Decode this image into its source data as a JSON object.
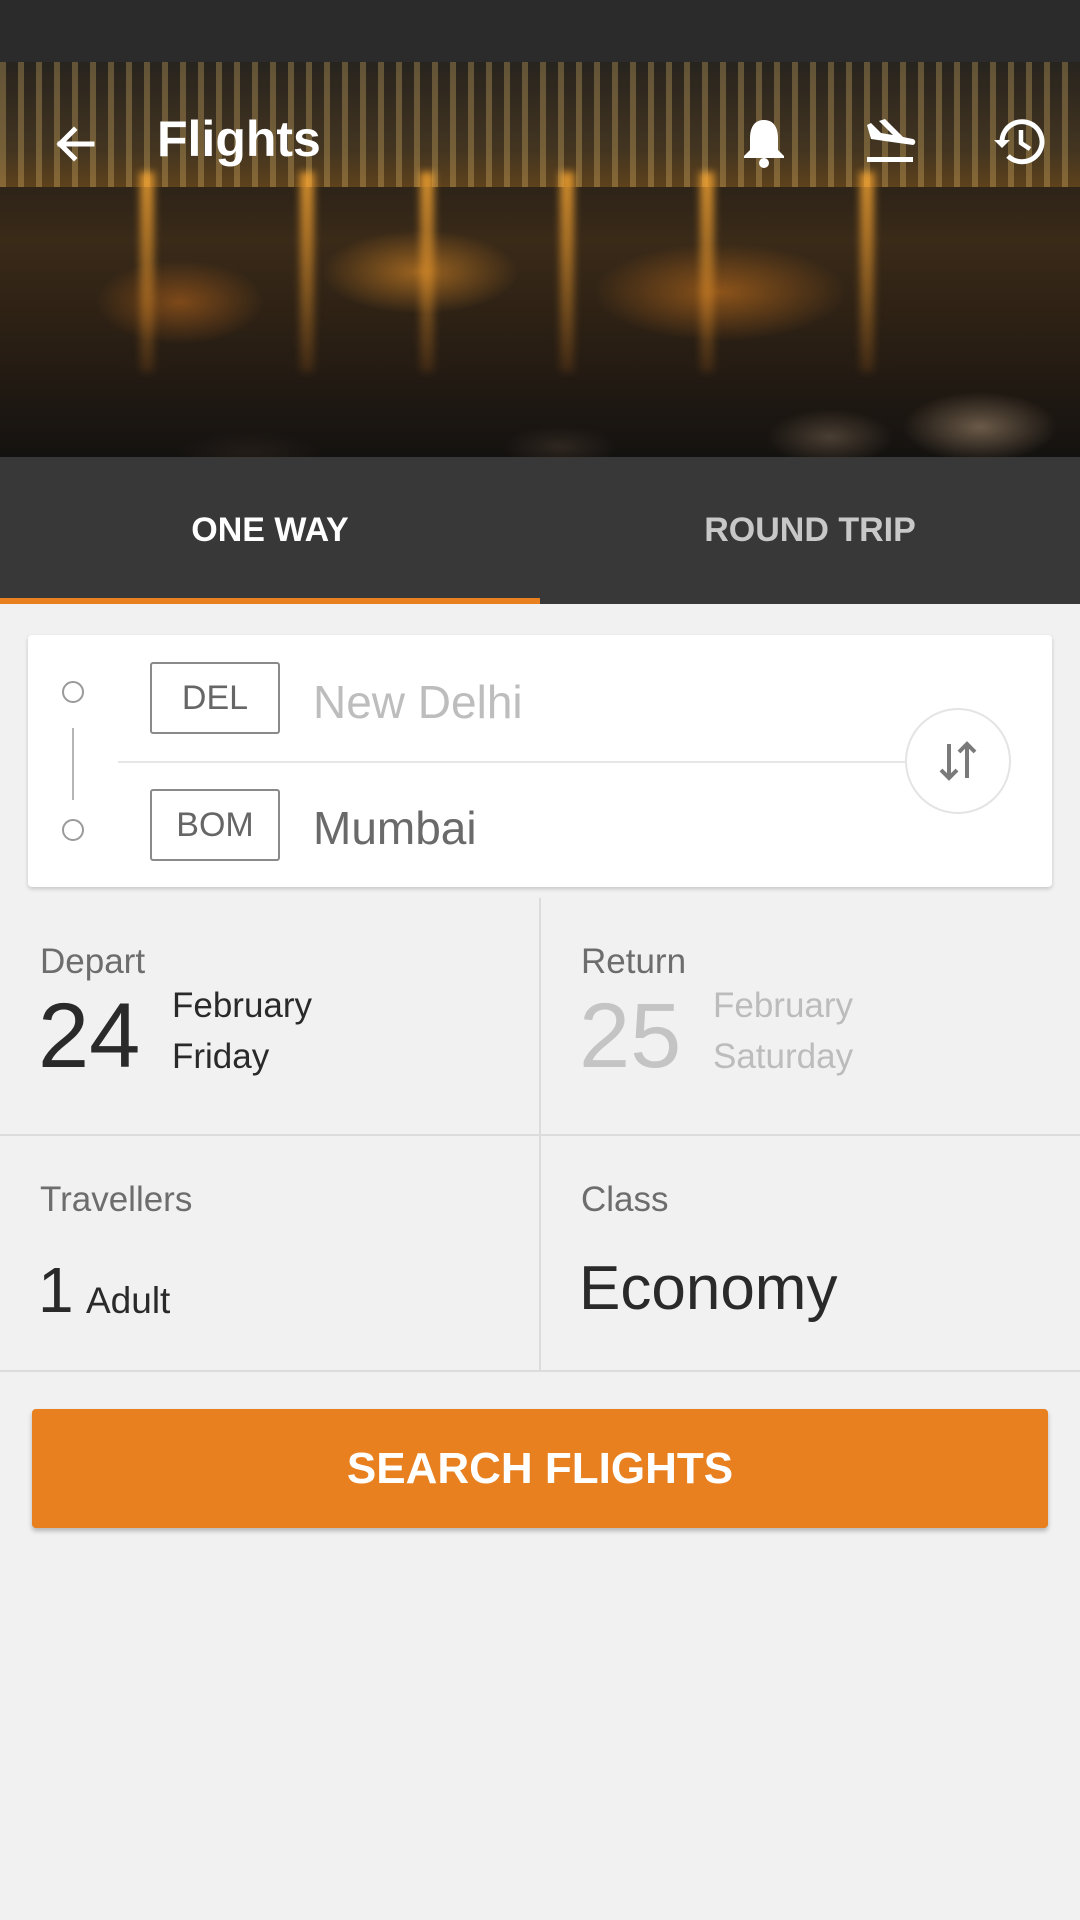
{
  "header": {
    "title": "Flights"
  },
  "icons": {
    "back": "arrow-left-icon",
    "notifications": "bell-icon",
    "landing": "flight-land-icon",
    "history": "history-icon",
    "swap": "swap-vertical-icon"
  },
  "tabs": [
    {
      "label": "ONE WAY",
      "active": true
    },
    {
      "label": "ROUND TRIP",
      "active": false
    }
  ],
  "route": {
    "from": {
      "code": "DEL",
      "city": "New Delhi"
    },
    "to": {
      "code": "BOM",
      "city": "Mumbai"
    }
  },
  "depart": {
    "label": "Depart",
    "day": "24",
    "month": "February",
    "weekday": "Friday"
  },
  "return": {
    "label": "Return",
    "day": "25",
    "month": "February",
    "weekday": "Saturday"
  },
  "travellers": {
    "label": "Travellers",
    "count": "1",
    "type": "Adult"
  },
  "class": {
    "label": "Class",
    "value": "Economy"
  },
  "search_button": {
    "label": "SEARCH FLIGHTS"
  },
  "colors": {
    "accent": "#e8801f",
    "tab_bar": "#383838",
    "status_bar": "#2b2b2b"
  }
}
